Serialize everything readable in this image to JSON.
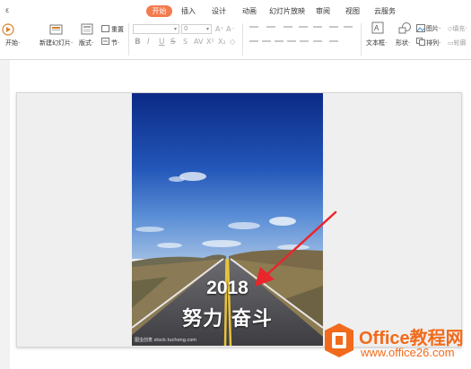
{
  "tabs": [
    {
      "label": "开始",
      "active": true
    },
    {
      "label": "插入",
      "active": false
    },
    {
      "label": "设计",
      "active": false
    },
    {
      "label": "动画",
      "active": false
    },
    {
      "label": "幻灯片放映",
      "active": false
    },
    {
      "label": "审阅",
      "active": false
    },
    {
      "label": "视图",
      "active": false
    },
    {
      "label": "云服务",
      "active": false
    }
  ],
  "tab_edge": "ε",
  "toolbar": {
    "from_start": "开始·",
    "new_slide": "新建幻灯片·",
    "layout": "版式·",
    "reset": "重置",
    "section": "节·",
    "font_name": "",
    "font_size": "0",
    "bold": "B",
    "italic": "I",
    "underline": "U",
    "strike": "S",
    "textbox": "文本框·",
    "shape": "形状·",
    "picture": "图片·",
    "fill": "填充·",
    "arrange": "排列·",
    "outline": "轮廓"
  },
  "slide": {
    "year": "2018",
    "slogan": "努力 奋斗",
    "photo_credit": "图虫创意 stock.tuchong.com"
  },
  "logo": {
    "brand": "Office教程网",
    "domain": "www.office26.com"
  },
  "colors": {
    "accent": "#f37b4f",
    "arrow": "#e8262b",
    "logo": "#f26a1b"
  }
}
